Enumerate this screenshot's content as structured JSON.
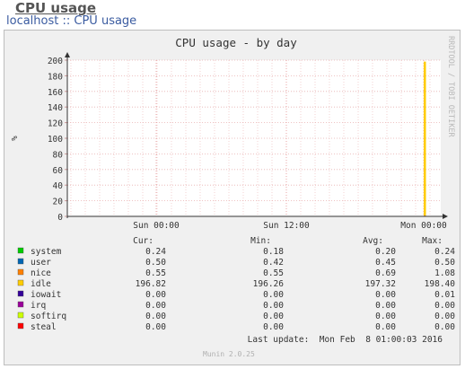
{
  "page": {
    "title": "CPU usage",
    "breadcrumb": {
      "host": "localhost",
      "separator": " :: ",
      "current": "CPU usage"
    }
  },
  "chart_data": {
    "type": "area",
    "title": "CPU usage - by day",
    "ylabel": "%",
    "ylim": [
      0,
      200
    ],
    "yticks": [
      0,
      20,
      40,
      60,
      80,
      100,
      120,
      140,
      160,
      180,
      200
    ],
    "xticks": [
      "Sun 00:00",
      "Sun 12:00",
      "Mon 00:00"
    ],
    "grid": true,
    "vertical_side_label": "RRDTOOL / TOBI OETIKER",
    "table_headers": [
      "Cur:",
      "Min:",
      "Avg:",
      "Max:"
    ],
    "series": [
      {
        "name": "system",
        "color": "#00cc00",
        "cur": "0.24",
        "min": "0.18",
        "avg": "0.20",
        "max": "0.24"
      },
      {
        "name": "user",
        "color": "#0066b3",
        "cur": "0.50",
        "min": "0.42",
        "avg": "0.45",
        "max": "0.50"
      },
      {
        "name": "nice",
        "color": "#ff8000",
        "cur": "0.55",
        "min": "0.55",
        "avg": "0.69",
        "max": "1.08"
      },
      {
        "name": "idle",
        "color": "#ffcc00",
        "cur": "196.82",
        "min": "196.26",
        "avg": "197.32",
        "max": "198.40"
      },
      {
        "name": "iowait",
        "color": "#330099",
        "cur": "0.00",
        "min": "0.00",
        "avg": "0.00",
        "max": "0.01"
      },
      {
        "name": "irq",
        "color": "#990099",
        "cur": "0.00",
        "min": "0.00",
        "avg": "0.00",
        "max": "0.00"
      },
      {
        "name": "softirq",
        "color": "#ccff00",
        "cur": "0.00",
        "min": "0.00",
        "avg": "0.00",
        "max": "0.00"
      },
      {
        "name": "steal",
        "color": "#ff0000",
        "cur": "0.00",
        "min": "0.00",
        "avg": "0.00",
        "max": "0.00"
      }
    ],
    "last_update": "Last update:  Mon Feb  8 01:00:03 2016",
    "footer": "Munin 2.0.25"
  }
}
